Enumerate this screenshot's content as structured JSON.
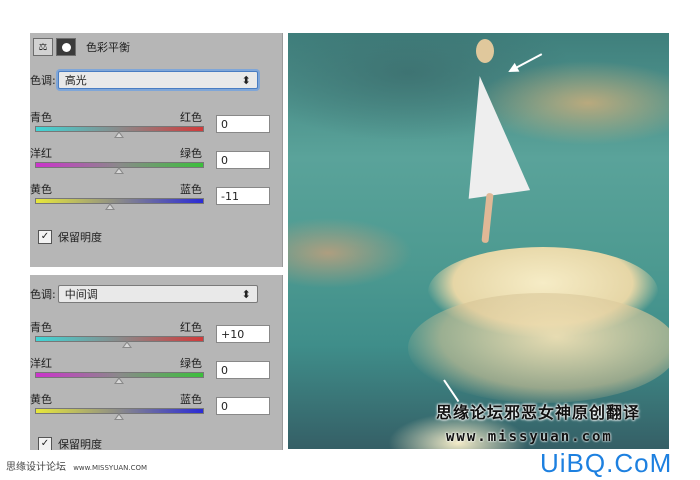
{
  "panel_top": {
    "title": "色彩平衡",
    "tone_label": "色调:",
    "tone_value": "高光",
    "sliders": [
      {
        "left": "青色",
        "right": "红色",
        "value": "0",
        "level": 0.5
      },
      {
        "left": "洋红",
        "right": "绿色",
        "value": "0",
        "level": 0.5
      },
      {
        "left": "黄色",
        "right": "蓝色",
        "value": "-11",
        "level": 0.45
      }
    ],
    "preserve": "保留明度",
    "preserve_checked": "✓"
  },
  "panel_bottom": {
    "tone_label": "色调:",
    "tone_value": "中间调",
    "sliders": [
      {
        "left": "青色",
        "right": "红色",
        "value": "+10",
        "level": 0.55
      },
      {
        "left": "洋红",
        "right": "绿色",
        "value": "0",
        "level": 0.5
      },
      {
        "left": "黄色",
        "right": "蓝色",
        "value": "0",
        "level": 0.5
      }
    ],
    "preserve": "保留明度",
    "preserve_checked": "✓"
  },
  "photo": {
    "watermark_cn": "思缘论坛邪恶女神原创翻译",
    "watermark_url": "www.missyuan.com"
  },
  "footer": {
    "site": "思缘设计论坛",
    "site_url": "www.MISSYUAN.COM",
    "logo": "UiBQ.CoM"
  },
  "icons": {
    "select_arrow": "⬍",
    "scale": "⚖"
  }
}
